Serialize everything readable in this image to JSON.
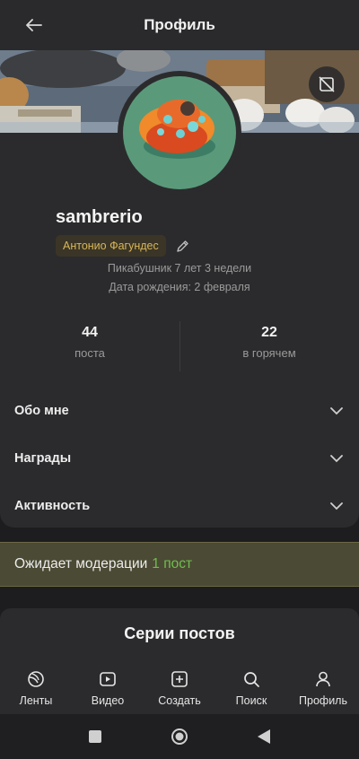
{
  "header": {
    "title": "Профиль"
  },
  "profile": {
    "username": "sambrerio",
    "tag": "Антонио Фагундес",
    "tenure": "Пикабушник 7 лет 3 недели",
    "birthday": "Дата рождения: 2 февраля"
  },
  "stats": [
    {
      "value": "44",
      "label": "поста"
    },
    {
      "value": "22",
      "label": "в горячем"
    }
  ],
  "sections": [
    {
      "label": "Обо мне"
    },
    {
      "label": "Награды"
    },
    {
      "label": "Активность"
    }
  ],
  "moderation": {
    "text": "Ожидает модерации",
    "count": "1 пост"
  },
  "series": {
    "title": "Серии постов"
  },
  "nav": [
    {
      "label": "Ленты",
      "icon": "feeds-icon"
    },
    {
      "label": "Видео",
      "icon": "video-icon"
    },
    {
      "label": "Создать",
      "icon": "create-icon"
    },
    {
      "label": "Поиск",
      "icon": "search-icon"
    },
    {
      "label": "Профиль",
      "icon": "profile-icon"
    }
  ],
  "colors": {
    "accent_tag": "#d8b65a",
    "moderation_count": "#6fbf4f",
    "moderation_bg": "#4b4a34"
  }
}
